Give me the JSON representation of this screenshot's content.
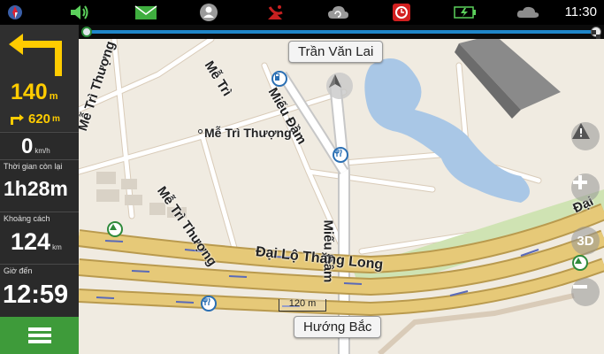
{
  "status_bar": {
    "time": "11:30",
    "icons": [
      "compass-icon",
      "volume-icon",
      "message-icon",
      "profile-icon",
      "satellite-icon",
      "cloud-sync-icon",
      "record-icon",
      "battery-charging-icon",
      "weather-icon"
    ]
  },
  "route_progress": {
    "fraction_complete": 0.0
  },
  "guidance": {
    "turn_distance_value": "140",
    "turn_distance_unit": "m",
    "next_turn_value": "620",
    "next_turn_unit": "m",
    "speed_value": "0",
    "speed_unit": "km/h",
    "time_left_label": "Thời gian còn lại",
    "time_left_value": "1h28m",
    "distance_label": "Khoảng cách",
    "distance_value": "124",
    "distance_unit": "km",
    "arrival_label": "Giờ đến",
    "arrival_value": "12:59"
  },
  "map": {
    "current_street": "Trần Văn Lai",
    "direction_button": "Hướng Bắc",
    "scale_label": "120 m",
    "labels": {
      "me_tri_left": "Mễ Trì Thượng",
      "me_tri_top": "Mễ Trì",
      "mieu_dam_diag": "Miếu Đầm",
      "me_tri_thuong_place": "Mễ Trì Thượng",
      "me_tri_thuong_road": "Mễ Trì Thượng",
      "mieu_dam_vert": "Miếu Đầm",
      "dai_lo": "Đại Lộ Thăng Long",
      "dai_right": "Đại"
    },
    "controls": {
      "warning": "!",
      "zoom_in": "+",
      "view_3d": "3D",
      "zoom_out": "−"
    },
    "colors": {
      "water": "#a9c7e6",
      "highway": "#e6c978",
      "highway_edge": "#b99a4e",
      "park": "#cfe3b3",
      "background": "#f0ebe1",
      "road": "#ffffff"
    }
  }
}
